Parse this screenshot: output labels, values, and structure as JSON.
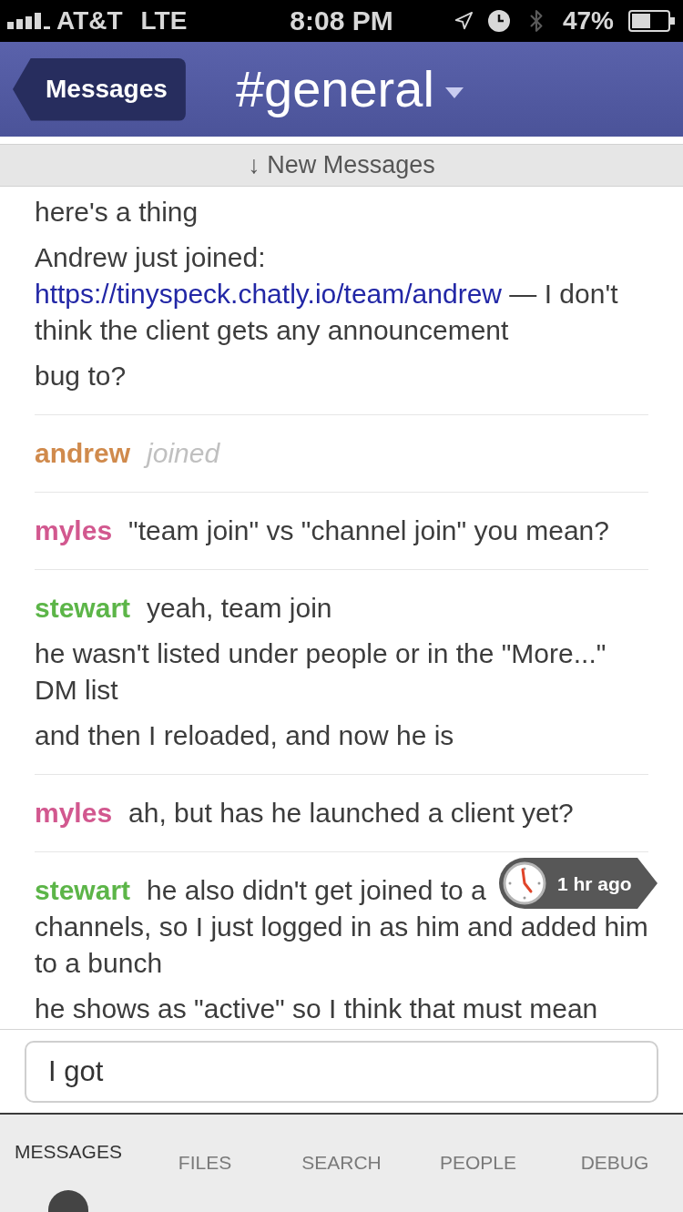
{
  "status_bar": {
    "carrier": "AT&T",
    "network": "LTE",
    "time": "8:08 PM",
    "battery": "47%"
  },
  "header": {
    "back_button": "Messages",
    "channel": "#general"
  },
  "new_messages_banner": {
    "label": "↓ New Messages"
  },
  "message_groups": [
    {
      "messages": [
        {
          "kind": "text",
          "text": "here's a thing"
        },
        {
          "kind": "text",
          "parts": [
            {
              "kind": "text",
              "text": "Andrew just joined: "
            },
            {
              "kind": "link",
              "text": "https://tinyspeck.chatly.io/team/andrew"
            },
            {
              "kind": "text",
              "text": " — I don't think the client gets any announcement"
            }
          ]
        },
        {
          "kind": "text",
          "text": "bug to?"
        }
      ]
    },
    {
      "author": "andrew",
      "color": "#d08a4c",
      "messages": [
        {
          "kind": "event",
          "text": "joined"
        }
      ]
    },
    {
      "author": "myles",
      "color": "#d2588f",
      "messages": [
        {
          "kind": "text",
          "text": "\"team join\" vs \"channel join\" you mean?"
        }
      ]
    },
    {
      "author": "stewart",
      "color": "#5cb548",
      "messages": [
        {
          "kind": "text",
          "text": "yeah, team join"
        },
        {
          "kind": "text",
          "text": "he wasn't listed under people or in the \"More...\" DM list"
        },
        {
          "kind": "text",
          "text": "and then I reloaded, and now he is"
        }
      ]
    },
    {
      "author": "myles",
      "color": "#d2588f",
      "messages": [
        {
          "kind": "text",
          "text": "ah, but has he launched a client yet?"
        }
      ]
    },
    {
      "author": "stewart",
      "color": "#5cb548",
      "messages": [
        {
          "kind": "covered",
          "text": "he also didn't get joined to a",
          "time_badge": "1 hr ago",
          "text_continued": "channels, so I just logged in as him and added him to a bunch"
        },
        {
          "kind": "text",
          "text": "he shows as \"active\" so I think that must mean"
        }
      ]
    }
  ],
  "composer": {
    "value": "I got"
  },
  "tab_bar": {
    "tabs": [
      {
        "label": "MESSAGES",
        "selected": true
      },
      {
        "label": "FILES",
        "selected": false
      },
      {
        "label": "SEARCH",
        "selected": false
      },
      {
        "label": "PEOPLE",
        "selected": false
      },
      {
        "label": "DEBUG",
        "selected": false
      }
    ]
  }
}
